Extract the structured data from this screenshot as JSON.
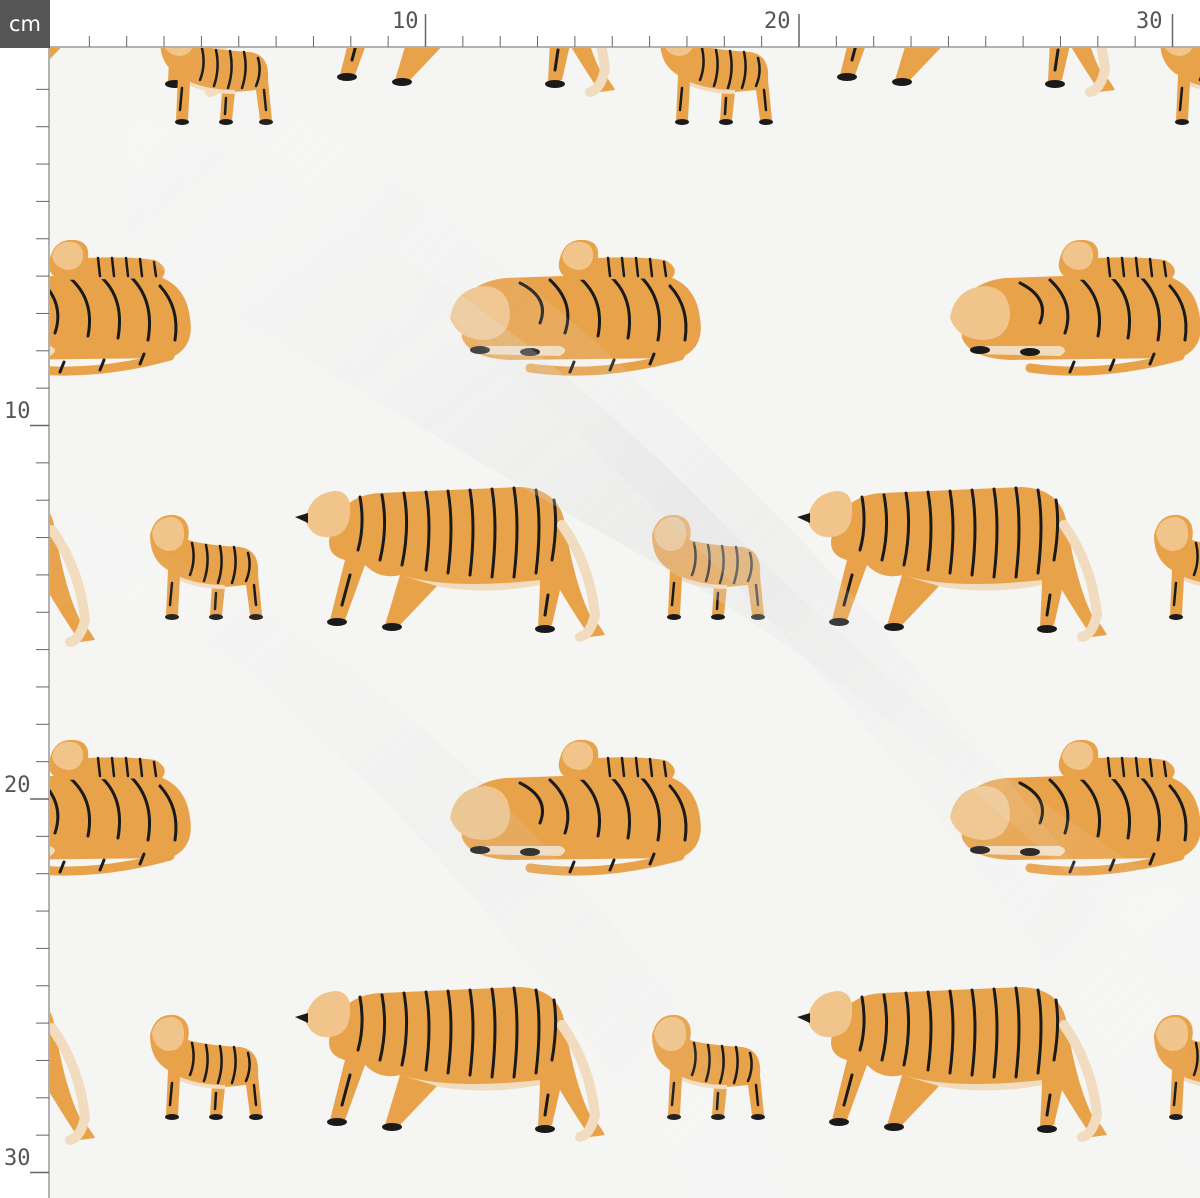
{
  "ruler": {
    "unit_label": "cm",
    "top_labels": [
      "10",
      "20",
      "30"
    ],
    "left_labels": [
      "10",
      "20",
      "30"
    ]
  },
  "fabric": {
    "background_color": "#f5f5f4",
    "pattern": {
      "motifs": [
        "walking-tiger",
        "standing-cub",
        "resting-tiger-with-cub"
      ],
      "colors": {
        "fur_orange": "#e8a24a",
        "fur_light": "#f0c48a",
        "belly_cream": "#f2dcc0",
        "stripe_black": "#1a1a1a"
      }
    }
  }
}
